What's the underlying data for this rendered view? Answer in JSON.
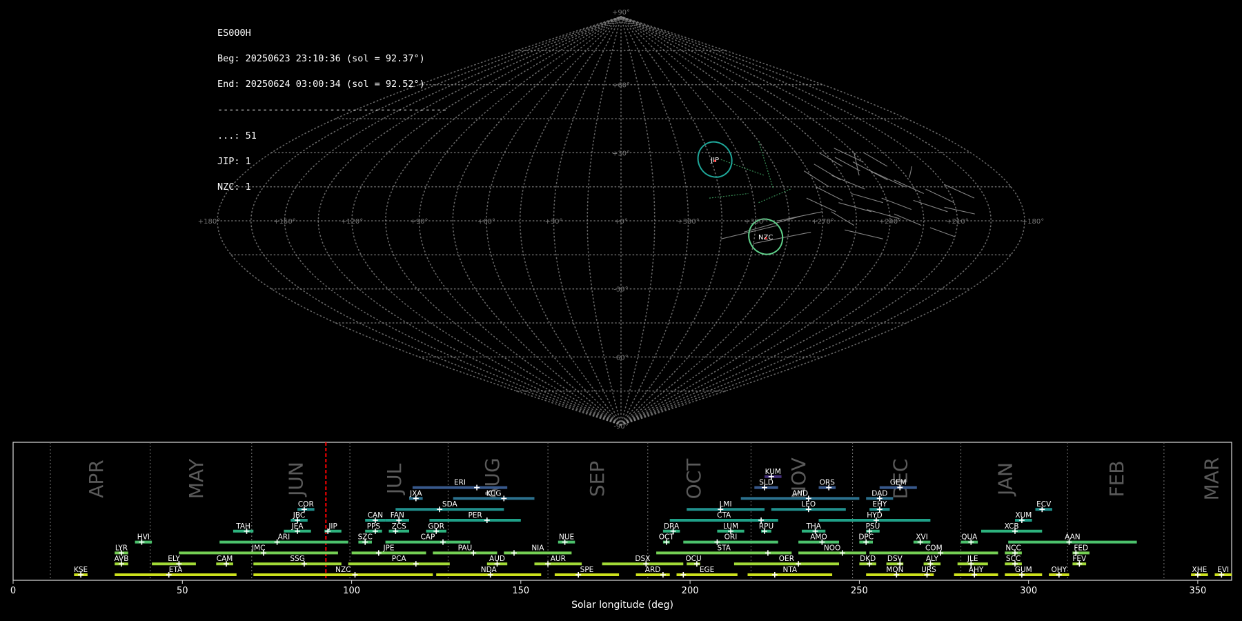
{
  "info": {
    "lines": [
      "ES000H",
      "Beg: 20250623 23:10:36 (sol = 92.37°)",
      "End: 20250624 03:00:34 (sol = 92.52°)",
      "-----------------------------------------",
      "...: 51",
      "JIP: 1",
      "NZC: 1"
    ]
  },
  "colors": {
    "background": "#000000",
    "grid": "#8a8a8a",
    "tracks": "#9a9a9a",
    "circle_jip": "#1fa89a",
    "circle_nzc": "#5fd08a",
    "marker": "#ffffff",
    "solar_marker": "#ff0000",
    "month_label": "#5a5a5a"
  },
  "chart_data": [
    {
      "type": "scatter",
      "projection": "sinusoidal",
      "lon_ticks": [
        "+180°",
        "+150°",
        "+120°",
        "+90°",
        "+60°",
        "+30°",
        "+0°",
        "+330°",
        "+300°",
        "+270°",
        "+240°",
        "+210°",
        "+180°"
      ],
      "lat_ticks": [
        "+90°",
        "+60°",
        "+30°",
        "-30°",
        "-60°",
        "-90°"
      ],
      "grid": true,
      "radiants": [
        {
          "code": "JIP",
          "lon": 313,
          "lat": 27,
          "color": "#1fa89a"
        },
        {
          "code": "NZC",
          "lon": 295,
          "lat": -7,
          "color": "#5fd08a"
        }
      ]
    },
    {
      "type": "timeline",
      "xlabel": "Solar longitude (deg)",
      "xlim": [
        0,
        360
      ],
      "xticks": [
        "0",
        "50",
        "100",
        "150",
        "200",
        "250",
        "300",
        "350"
      ],
      "xtick_values": [
        0,
        50,
        100,
        150,
        200,
        250,
        300,
        350
      ],
      "current_sol": 92.4,
      "months": [
        {
          "name": "APR",
          "start": 11,
          "center": 24.5
        },
        {
          "name": "MAY",
          "start": 40.5,
          "center": 54
        },
        {
          "name": "JUN",
          "start": 70.5,
          "center": 83.5
        },
        {
          "name": "JUL",
          "start": 99.5,
          "center": 112.5
        },
        {
          "name": "AUG",
          "start": 128.5,
          "center": 141.5
        },
        {
          "name": "SEP",
          "start": 158,
          "center": 172.5
        },
        {
          "name": "OCT",
          "start": 187.5,
          "center": 201
        },
        {
          "name": "NOV",
          "start": 218,
          "center": 232
        },
        {
          "name": "DEC",
          "start": 248,
          "center": 262
        },
        {
          "name": "JAN",
          "start": 280,
          "center": 293
        },
        {
          "name": "FEB",
          "start": 311.5,
          "center": 326
        },
        {
          "name": "MAR",
          "start": 340,
          "center": 354
        }
      ],
      "showers": [
        {
          "code": "KSE",
          "start": 18,
          "end": 22,
          "peak": 20,
          "row": 0
        },
        {
          "code": "ETA",
          "start": 30,
          "end": 66,
          "peak": 46,
          "row": 0
        },
        {
          "code": "NZC",
          "start": 71,
          "end": 124,
          "peak": 101,
          "row": 0
        },
        {
          "code": "NDA",
          "start": 125,
          "end": 156,
          "peak": 141,
          "row": 0
        },
        {
          "code": "SPE",
          "start": 160,
          "end": 179,
          "peak": 167,
          "row": 0
        },
        {
          "code": "ARD",
          "start": 184,
          "end": 194,
          "peak": 192,
          "row": 0
        },
        {
          "code": "EGE",
          "start": 196,
          "end": 214,
          "peak": 198,
          "row": 0
        },
        {
          "code": "NTA",
          "start": 217,
          "end": 242,
          "peak": 225,
          "row": 0
        },
        {
          "code": "MON",
          "start": 252,
          "end": 269,
          "peak": 261,
          "row": 0
        },
        {
          "code": "URS",
          "start": 269,
          "end": 272,
          "peak": 270,
          "row": 0
        },
        {
          "code": "AHY",
          "start": 278,
          "end": 291,
          "peak": 284,
          "row": 0
        },
        {
          "code": "GUM",
          "start": 293,
          "end": 304,
          "peak": 298,
          "row": 0
        },
        {
          "code": "OHY",
          "start": 306,
          "end": 312,
          "peak": 309,
          "row": 0
        },
        {
          "code": "XHE",
          "start": 348,
          "end": 353,
          "peak": 350,
          "row": 0
        },
        {
          "code": "EVI",
          "start": 355,
          "end": 360,
          "peak": 357,
          "row": 0
        },
        {
          "code": "AVB",
          "start": 30,
          "end": 34,
          "peak": 32,
          "row": 1
        },
        {
          "code": "ELY",
          "start": 41,
          "end": 54,
          "peak": 49,
          "row": 1
        },
        {
          "code": "CAM",
          "start": 60,
          "end": 65,
          "peak": 63,
          "row": 1
        },
        {
          "code": "SSG",
          "start": 71,
          "end": 97,
          "peak": 86,
          "row": 1
        },
        {
          "code": "PCA",
          "start": 99,
          "end": 129,
          "peak": 119,
          "row": 1
        },
        {
          "code": "AUD",
          "start": 140,
          "end": 146,
          "peak": 143,
          "row": 1
        },
        {
          "code": "AUR",
          "start": 154,
          "end": 168,
          "peak": 158,
          "row": 1
        },
        {
          "code": "DSX",
          "start": 174,
          "end": 198,
          "peak": 187,
          "row": 1
        },
        {
          "code": "OCU",
          "start": 199,
          "end": 203,
          "peak": 202,
          "row": 1
        },
        {
          "code": "OER",
          "start": 213,
          "end": 244,
          "peak": 232,
          "row": 1
        },
        {
          "code": "DKD",
          "start": 250,
          "end": 255,
          "peak": 253,
          "row": 1
        },
        {
          "code": "DSV",
          "start": 258,
          "end": 263,
          "peak": 262,
          "row": 1
        },
        {
          "code": "ALY",
          "start": 269,
          "end": 274,
          "peak": 271,
          "row": 1
        },
        {
          "code": "JLE",
          "start": 279,
          "end": 288,
          "peak": 283,
          "row": 1
        },
        {
          "code": "SCC",
          "start": 293,
          "end": 298,
          "peak": 296,
          "row": 1
        },
        {
          "code": "FEV",
          "start": 313,
          "end": 317,
          "peak": 315,
          "row": 1
        },
        {
          "code": "LYR",
          "start": 30,
          "end": 34,
          "peak": 32,
          "row": 2
        },
        {
          "code": "JMC",
          "start": 49,
          "end": 96,
          "peak": 74,
          "row": 2
        },
        {
          "code": "JPE",
          "start": 100,
          "end": 122,
          "peak": 108,
          "row": 2
        },
        {
          "code": "PAU",
          "start": 124,
          "end": 143,
          "peak": 136,
          "row": 2
        },
        {
          "code": "NIA",
          "start": 145,
          "end": 165,
          "peak": 148,
          "row": 2
        },
        {
          "code": "STA",
          "start": 190,
          "end": 230,
          "peak": 223,
          "row": 2
        },
        {
          "code": "NOO",
          "start": 232,
          "end": 252,
          "peak": 245,
          "row": 2
        },
        {
          "code": "COM",
          "start": 253,
          "end": 291,
          "peak": 274,
          "row": 2
        },
        {
          "code": "NCC",
          "start": 293,
          "end": 298,
          "peak": 296,
          "row": 2
        },
        {
          "code": "FED",
          "start": 313,
          "end": 318,
          "peak": 314,
          "row": 2
        },
        {
          "code": "HVI",
          "start": 36,
          "end": 41,
          "peak": 38,
          "row": 3
        },
        {
          "code": "ARI",
          "start": 61,
          "end": 99,
          "peak": 78,
          "row": 3
        },
        {
          "code": "SZC",
          "start": 102,
          "end": 106,
          "peak": 104,
          "row": 3
        },
        {
          "code": "CAP",
          "start": 110,
          "end": 135,
          "peak": 127,
          "row": 3
        },
        {
          "code": "NUE",
          "start": 161,
          "end": 166,
          "peak": 163,
          "row": 3
        },
        {
          "code": "OCT",
          "start": 192,
          "end": 194,
          "peak": 193,
          "row": 3
        },
        {
          "code": "ORI",
          "start": 198,
          "end": 226,
          "peak": 208,
          "row": 3
        },
        {
          "code": "AMO",
          "start": 232,
          "end": 244,
          "peak": 239,
          "row": 3
        },
        {
          "code": "DPC",
          "start": 250,
          "end": 254,
          "peak": 252,
          "row": 3
        },
        {
          "code": "XVI",
          "start": 266,
          "end": 271,
          "peak": 268,
          "row": 3
        },
        {
          "code": "QUA",
          "start": 280,
          "end": 285,
          "peak": 283,
          "row": 3
        },
        {
          "code": "AAN",
          "start": 294,
          "end": 332,
          "peak": 312,
          "row": 3
        },
        {
          "code": "TAH",
          "start": 65,
          "end": 71,
          "peak": 69,
          "row": 4
        },
        {
          "code": "JEA",
          "start": 80,
          "end": 88,
          "peak": 84,
          "row": 4
        },
        {
          "code": "JIP",
          "start": 92,
          "end": 97,
          "peak": 93,
          "row": 4
        },
        {
          "code": "PPS",
          "start": 104,
          "end": 109,
          "peak": 107,
          "row": 4
        },
        {
          "code": "ZCS",
          "start": 111,
          "end": 117,
          "peak": 113,
          "row": 4
        },
        {
          "code": "GDR",
          "start": 122,
          "end": 128,
          "peak": 125,
          "row": 4
        },
        {
          "code": "DRA",
          "start": 192,
          "end": 197,
          "peak": 195,
          "row": 4
        },
        {
          "code": "LUM",
          "start": 208,
          "end": 216,
          "peak": 212,
          "row": 4
        },
        {
          "code": "RPU",
          "start": 221,
          "end": 224,
          "peak": 222,
          "row": 4
        },
        {
          "code": "THA",
          "start": 233,
          "end": 240,
          "peak": 237,
          "row": 4
        },
        {
          "code": "PSU",
          "start": 252,
          "end": 256,
          "peak": 253,
          "row": 4
        },
        {
          "code": "XCB",
          "start": 286,
          "end": 304,
          "peak": 296,
          "row": 4
        },
        {
          "code": "JBC",
          "start": 82,
          "end": 87,
          "peak": 84,
          "row": 5
        },
        {
          "code": "CAN",
          "start": 104,
          "end": 110,
          "peak": 107,
          "row": 5
        },
        {
          "code": "FAN",
          "start": 110,
          "end": 117,
          "peak": 114,
          "row": 5
        },
        {
          "code": "PER",
          "start": 123,
          "end": 150,
          "peak": 140,
          "row": 5
        },
        {
          "code": "CTA",
          "start": 194,
          "end": 226,
          "peak": 221,
          "row": 5
        },
        {
          "code": "HYD",
          "start": 238,
          "end": 271,
          "peak": 255,
          "row": 5
        },
        {
          "code": "XUM",
          "start": 296,
          "end": 301,
          "peak": 298,
          "row": 5
        },
        {
          "code": "COR",
          "start": 84,
          "end": 89,
          "peak": 86,
          "row": 6
        },
        {
          "code": "SDA",
          "start": 113,
          "end": 145,
          "peak": 126,
          "row": 6
        },
        {
          "code": "LMI",
          "start": 199,
          "end": 222,
          "peak": 209,
          "row": 6
        },
        {
          "code": "LEO",
          "start": 224,
          "end": 246,
          "peak": 235,
          "row": 6
        },
        {
          "code": "EHY",
          "start": 253,
          "end": 259,
          "peak": 256,
          "row": 6
        },
        {
          "code": "ECV",
          "start": 302,
          "end": 307,
          "peak": 304,
          "row": 6
        },
        {
          "code": "JXA",
          "start": 117,
          "end": 121,
          "peak": 119,
          "row": 7
        },
        {
          "code": "KCG",
          "start": 130,
          "end": 154,
          "peak": 145,
          "row": 7
        },
        {
          "code": "AND",
          "start": 215,
          "end": 250,
          "peak": 235,
          "row": 7
        },
        {
          "code": "DAD",
          "start": 252,
          "end": 260,
          "peak": 256,
          "row": 7
        },
        {
          "code": "ERI",
          "start": 118,
          "end": 146,
          "peak": 137,
          "row": 8
        },
        {
          "code": "SLD",
          "start": 219,
          "end": 226,
          "peak": 222,
          "row": 8
        },
        {
          "code": "ORS",
          "start": 238,
          "end": 243,
          "peak": 241,
          "row": 8
        },
        {
          "code": "GEM",
          "start": 256,
          "end": 267,
          "peak": 262,
          "row": 8
        },
        {
          "code": "KUM",
          "start": 222,
          "end": 227,
          "peak": 224,
          "row": 9
        }
      ]
    }
  ]
}
